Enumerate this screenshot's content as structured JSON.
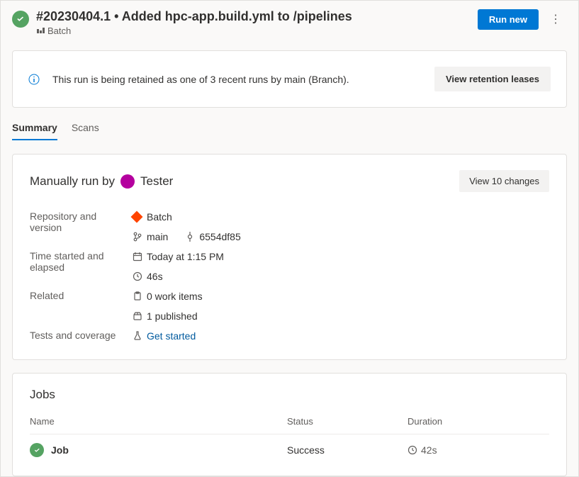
{
  "header": {
    "title": "#20230404.1 • Added hpc-app.build.yml to /pipelines",
    "subtitle": "Batch",
    "run_new_label": "Run new"
  },
  "retention": {
    "message": "This run is being retained as one of 3 recent runs by main (Branch).",
    "button": "View retention leases"
  },
  "tabs": {
    "summary": "Summary",
    "scans": "Scans"
  },
  "summary": {
    "run_by_prefix": "Manually run by",
    "run_by_user": "Tester",
    "view_changes": "View 10 changes",
    "labels": {
      "repo_version": "Repository and version",
      "time": "Time started and elapsed",
      "related": "Related",
      "tests": "Tests and coverage"
    },
    "repo": "Batch",
    "branch": "main",
    "commit": "6554df85",
    "started": "Today at 1:15 PM",
    "elapsed": "46s",
    "work_items": "0 work items",
    "published": "1 published",
    "get_started": "Get started"
  },
  "jobs": {
    "title": "Jobs",
    "headers": {
      "name": "Name",
      "status": "Status",
      "duration": "Duration"
    },
    "row": {
      "name": "Job",
      "status": "Success",
      "duration": "42s"
    }
  }
}
